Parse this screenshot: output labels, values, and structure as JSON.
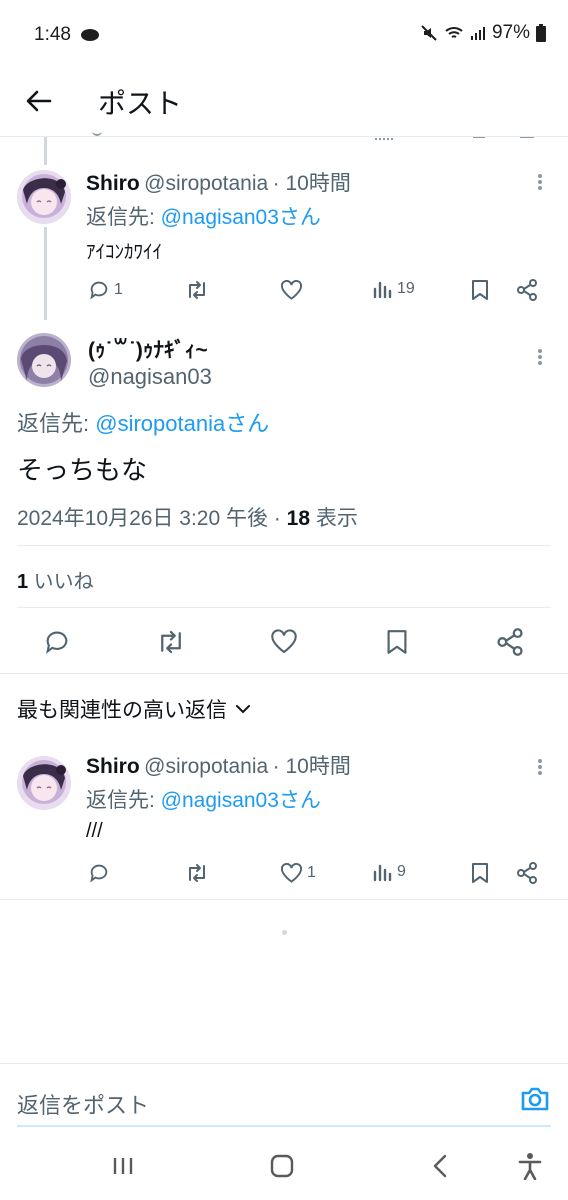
{
  "status": {
    "time": "1:48",
    "battery": "97%"
  },
  "header": {
    "title": "ポスト"
  },
  "reply1": {
    "name": "Shiro",
    "handle": "@siropotania",
    "time": "· 10時間",
    "reply_to_prefix": "返信先: ",
    "reply_to": "@nagisan03さん",
    "text": "ｱｲｺﾝｶﾜｲｲ",
    "replies": "1",
    "likes": "",
    "views": "19"
  },
  "main": {
    "name": "(ｩ˙꒳​˙)ｩﾅｷﾞｨ~",
    "handle": "@nagisan03",
    "reply_to_prefix": "返信先: ",
    "reply_to": "@siropotaniaさん",
    "text": "そっちもな",
    "timestamp": "2024年10月26日 3:20 午後 · ",
    "views_count": "18",
    "views_label": " 表示",
    "likes_count": "1",
    "likes_label": " いいね"
  },
  "sort": {
    "label": "最も関連性の高い返信"
  },
  "reply2": {
    "name": "Shiro",
    "handle": "@siropotania",
    "time": "· 10時間",
    "reply_to_prefix": "返信先: ",
    "reply_to": "@nagisan03さん",
    "text": "///",
    "replies": "",
    "likes": "1",
    "views": "9"
  },
  "compose": {
    "placeholder": "返信をポスト"
  },
  "colors": {
    "accent": "#1d9bf0",
    "muted": "#536471",
    "divider": "#e6ecf0"
  }
}
